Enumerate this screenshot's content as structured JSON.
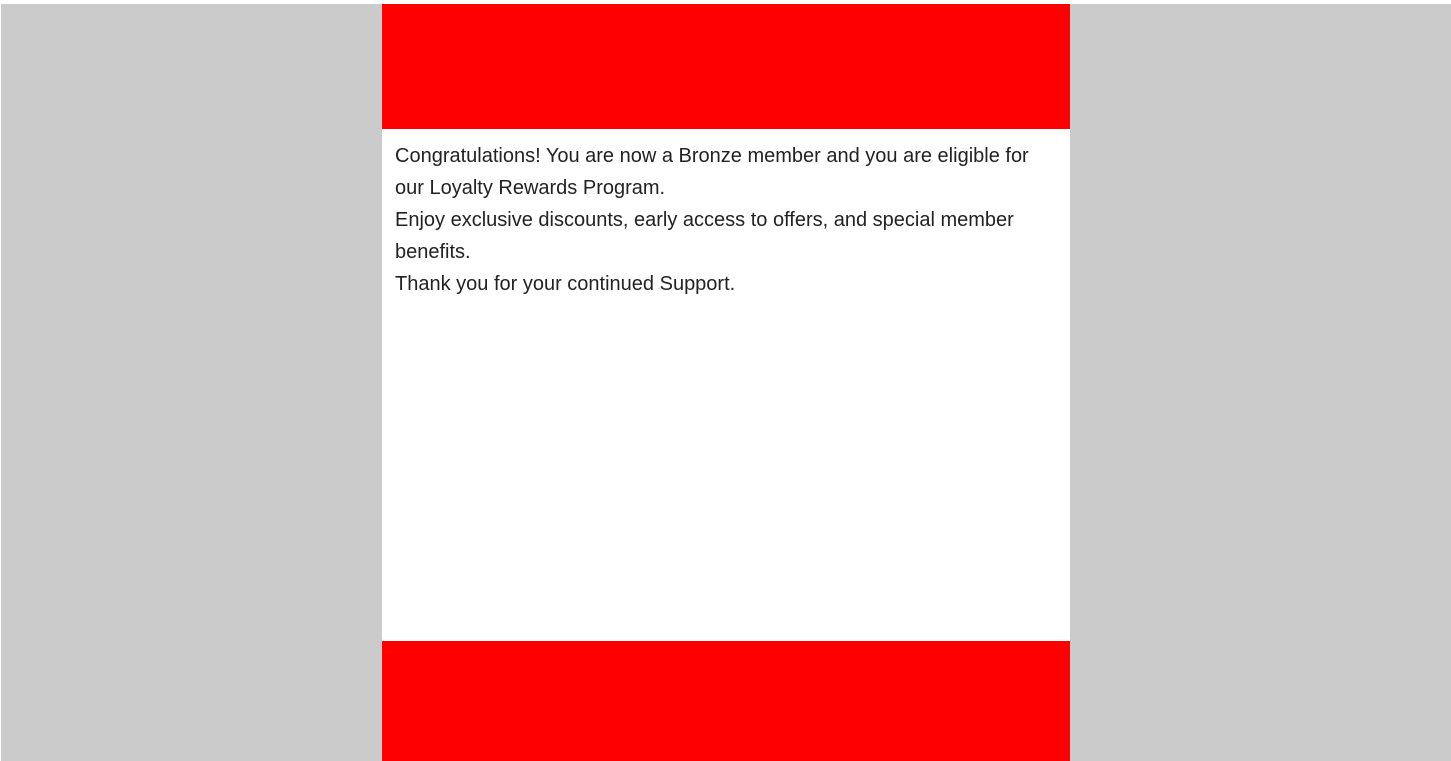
{
  "colors": {
    "page_background": "#cbcbcb",
    "card_background": "#ffffff",
    "banner": "#ff0000",
    "text": "#222222"
  },
  "message": {
    "line1": "Congratulations! You are now a Bronze member and you are eligible for our Loyalty Rewards Program.",
    "line2": "Enjoy exclusive discounts, early access to offers, and special member benefits.",
    "line3": "Thank you for your continued Support."
  }
}
